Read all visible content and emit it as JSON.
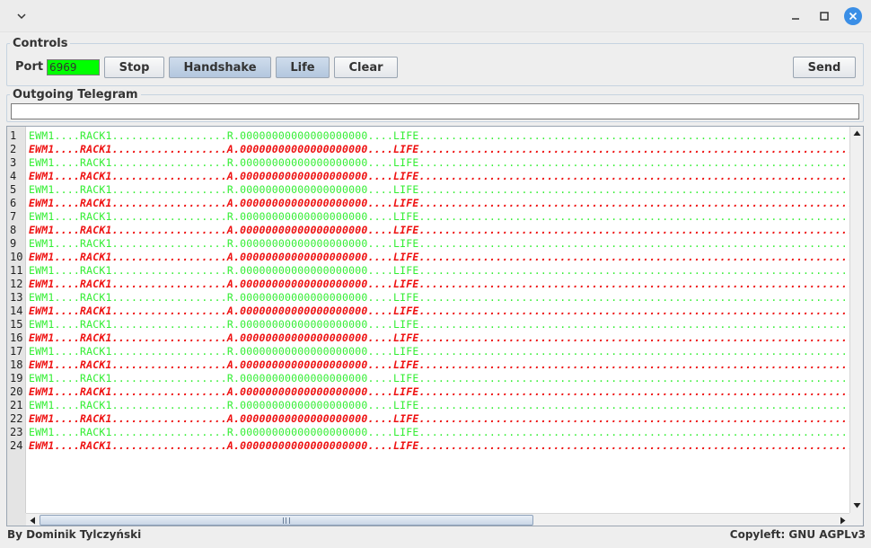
{
  "window": {
    "icons": {
      "menu": "chevron-down-icon",
      "minimize": "minimize-icon",
      "maximize": "maximize-icon",
      "close": "close-icon"
    },
    "close_color": "#3a8ee6"
  },
  "controls": {
    "title": "Controls",
    "port_label": "Port",
    "port_value": "6969",
    "port_bg": "#00ff00",
    "buttons": {
      "stop": "Stop",
      "handshake": "Handshake",
      "life": "Life",
      "clear": "Clear",
      "send": "Send"
    }
  },
  "telegram": {
    "title": "Outgoing Telegram",
    "value": ""
  },
  "log": {
    "colors": {
      "incoming": "#33ee33",
      "outgoing": "#ee1111"
    },
    "lines": [
      {
        "n": "1",
        "kind": "in",
        "text": "EWM1....RACK1..................R.00000000000000000000....LIFE.........................................................................................................."
      },
      {
        "n": "2",
        "kind": "out",
        "text": "EWM1....RACK1..................A.00000000000000000000....LIFE.........................................................................................................."
      },
      {
        "n": "3",
        "kind": "in",
        "text": "EWM1....RACK1..................R.00000000000000000000....LIFE.........................................................................................................."
      },
      {
        "n": "4",
        "kind": "out",
        "text": "EWM1....RACK1..................A.00000000000000000000....LIFE.........................................................................................................."
      },
      {
        "n": "5",
        "kind": "in",
        "text": "EWM1....RACK1..................R.00000000000000000000....LIFE.........................................................................................................."
      },
      {
        "n": "6",
        "kind": "out",
        "text": "EWM1....RACK1..................A.00000000000000000000....LIFE.........................................................................................................."
      },
      {
        "n": "7",
        "kind": "in",
        "text": "EWM1....RACK1..................R.00000000000000000000....LIFE.........................................................................................................."
      },
      {
        "n": "8",
        "kind": "out",
        "text": "EWM1....RACK1..................A.00000000000000000000....LIFE.........................................................................................................."
      },
      {
        "n": "9",
        "kind": "in",
        "text": "EWM1....RACK1..................R.00000000000000000000....LIFE.........................................................................................................."
      },
      {
        "n": "10",
        "kind": "out",
        "text": "EWM1....RACK1..................A.00000000000000000000....LIFE.........................................................................................................."
      },
      {
        "n": "11",
        "kind": "in",
        "text": "EWM1....RACK1..................R.00000000000000000000....LIFE.........................................................................................................."
      },
      {
        "n": "12",
        "kind": "out",
        "text": "EWM1....RACK1..................A.00000000000000000000....LIFE.........................................................................................................."
      },
      {
        "n": "13",
        "kind": "in",
        "text": "EWM1....RACK1..................R.00000000000000000000....LIFE.........................................................................................................."
      },
      {
        "n": "14",
        "kind": "out",
        "text": "EWM1....RACK1..................A.00000000000000000000....LIFE.........................................................................................................."
      },
      {
        "n": "15",
        "kind": "in",
        "text": "EWM1....RACK1..................R.00000000000000000000....LIFE.........................................................................................................."
      },
      {
        "n": "16",
        "kind": "out",
        "text": "EWM1....RACK1..................A.00000000000000000000....LIFE.........................................................................................................."
      },
      {
        "n": "17",
        "kind": "in",
        "text": "EWM1....RACK1..................R.00000000000000000000....LIFE.........................................................................................................."
      },
      {
        "n": "18",
        "kind": "out",
        "text": "EWM1....RACK1..................A.00000000000000000000....LIFE.........................................................................................................."
      },
      {
        "n": "19",
        "kind": "in",
        "text": "EWM1....RACK1..................R.00000000000000000000....LIFE.........................................................................................................."
      },
      {
        "n": "20",
        "kind": "out",
        "text": "EWM1....RACK1..................A.00000000000000000000....LIFE.........................................................................................................."
      },
      {
        "n": "21",
        "kind": "in",
        "text": "EWM1....RACK1..................R.00000000000000000000....LIFE.........................................................................................................."
      },
      {
        "n": "22",
        "kind": "out",
        "text": "EWM1....RACK1..................A.00000000000000000000....LIFE.........................................................................................................."
      },
      {
        "n": "23",
        "kind": "in",
        "text": "EWM1....RACK1..................R.00000000000000000000....LIFE.........................................................................................................."
      },
      {
        "n": "24",
        "kind": "out",
        "text": "EWM1....RACK1..................A.00000000000000000000....LIFE.........................................................................................................."
      }
    ]
  },
  "footer": {
    "author": "By Dominik Tylczyński",
    "license": "Copyleft: GNU AGPLv3"
  }
}
